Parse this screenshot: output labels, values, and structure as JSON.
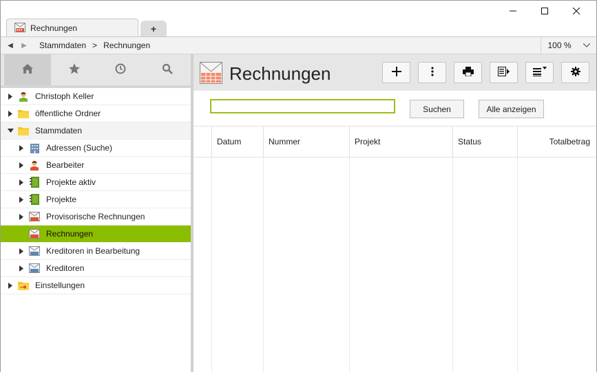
{
  "window": {
    "tab_title": "Rechnungen",
    "new_tab_label": "+",
    "minimize_icon": "minimize-icon",
    "maximize_icon": "maximize-icon",
    "close_icon": "close-icon"
  },
  "addressbar": {
    "breadcrumb": [
      "Stammdaten",
      "Rechnungen"
    ],
    "separator": ">",
    "zoom": "100 %"
  },
  "sidebar": {
    "tabs": [
      {
        "icon": "home-icon",
        "active": true
      },
      {
        "icon": "star-icon",
        "active": false
      },
      {
        "icon": "clock-icon",
        "active": false
      },
      {
        "icon": "search-icon",
        "active": false
      }
    ],
    "tree": [
      {
        "label": "Christoph Keller",
        "icon": "person-icon",
        "level": 0,
        "expanded": false
      },
      {
        "label": "öffentliche Ordner",
        "icon": "folder-icon",
        "level": 0,
        "expanded": false
      },
      {
        "label": "Stammdaten",
        "icon": "folder-icon",
        "level": 0,
        "expanded": true
      },
      {
        "label": "Adressen (Suche)",
        "icon": "building-icon",
        "level": 1
      },
      {
        "label": "Bearbeiter",
        "icon": "person-icon",
        "level": 1
      },
      {
        "label": "Projekte aktiv",
        "icon": "notebook-icon",
        "level": 1
      },
      {
        "label": "Projekte",
        "icon": "notebook-icon",
        "level": 1
      },
      {
        "label": "Provisorische Rechnungen",
        "icon": "invoice-icon",
        "level": 1
      },
      {
        "label": "Rechnungen",
        "icon": "invoice-icon",
        "level": 1,
        "selected": true
      },
      {
        "label": "Kreditoren in Bearbeitung",
        "icon": "creditor-icon",
        "level": 1
      },
      {
        "label": "Kreditoren",
        "icon": "creditor-icon",
        "level": 1
      },
      {
        "label": "Einstellungen",
        "icon": "settings-folder-icon",
        "level": 0,
        "expanded": false
      }
    ]
  },
  "main": {
    "title": "Rechnungen",
    "toolbar": [
      "add-icon",
      "more-vertical-icon",
      "print-icon",
      "export-icon",
      "sort-list-icon",
      "gear-icon"
    ],
    "search": {
      "value": "",
      "placeholder": ""
    },
    "search_button": "Suchen",
    "show_all_button": "Alle anzeigen",
    "columns": [
      "Datum",
      "Nummer",
      "Projekt",
      "Status",
      "Totalbetrag"
    ]
  },
  "colors": {
    "selection": "#8bbd00",
    "search_border": "#9ac01c",
    "folder": "#f5c518"
  }
}
